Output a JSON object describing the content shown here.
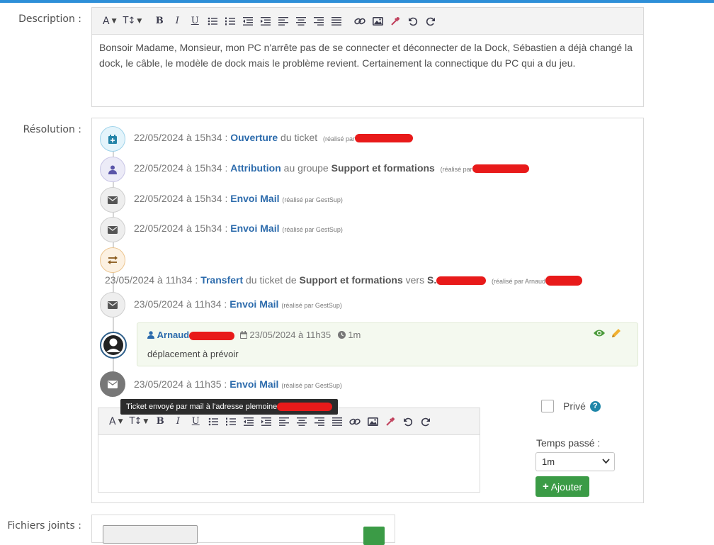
{
  "labels": {
    "description": "Description :",
    "resolution": "Résolution :",
    "attachments": "Fichiers joints :"
  },
  "description_text": "Bonsoir Madame, Monsieur, mon PC n'arrête pas de se connecter et déconnecter de la Dock, Sébastien a déjà changé la dock, le câble, le modèle de dock mais le problème revient. Certainement la connectique du PC qui a du jeu.",
  "timeline": {
    "e1": {
      "date": "22/05/2024 à 15h34 :",
      "action": "Ouverture",
      "rest": "du ticket",
      "by": "(réalisé par"
    },
    "e2": {
      "date": "22/05/2024 à 15h34 :",
      "action": "Attribution",
      "rest": "au groupe",
      "group": "Support et formations",
      "by": "(réalisé par"
    },
    "e3": {
      "date": "22/05/2024 à 15h34 :",
      "action": "Envoi Mail",
      "by": "(réalisé par GestSup)"
    },
    "e4": {
      "date": "22/05/2024 à 15h34 :",
      "action": "Envoi Mail",
      "by": "(réalisé par GestSup)"
    },
    "e5": {
      "date": "23/05/2024 à 11h34 :",
      "action": "Transfert",
      "rest": "du ticket de",
      "group": "Support et formations",
      "mid": "vers",
      "target": "S.",
      "by": "(réalisé par Arnaud"
    },
    "e6": {
      "date": "23/05/2024 à 11h34 :",
      "action": "Envoi Mail",
      "by": "(réalisé par GestSup)"
    },
    "comment": {
      "author": "Arnaud",
      "date": "23/05/2024 à 11h35",
      "duration": "1m",
      "text": "déplacement à prévoir"
    },
    "e7": {
      "date": "23/05/2024 à 11h35 :",
      "action": "Envoi Mail",
      "by": "(réalisé par GestSup)"
    }
  },
  "tooltip": "Ticket envoyé par mail à l'adresse plemoine",
  "form": {
    "private_label": "Privé",
    "help_glyph": "?",
    "time_label": "Temps passé :",
    "time_value": "1m",
    "add_button": "Ajouter"
  },
  "colors": {
    "accent": "#2e8fd8",
    "link": "#2c6bac",
    "success": "#3b9b46",
    "redaction": "#e81a1a",
    "comment_bg": "#f4f9ef"
  }
}
